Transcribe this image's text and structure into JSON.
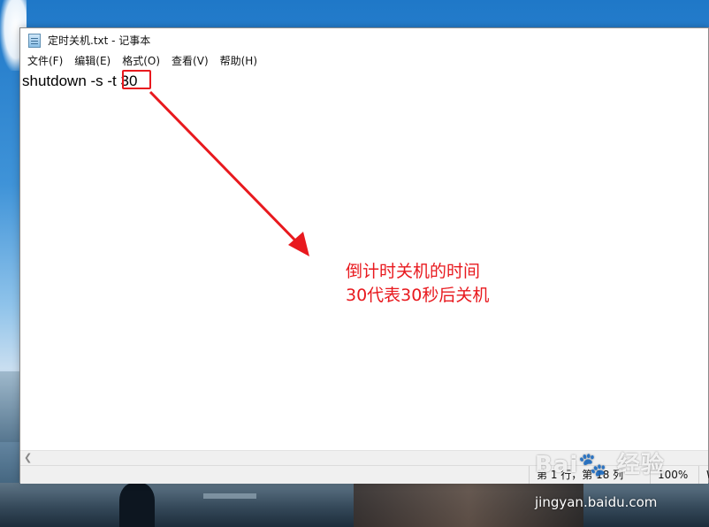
{
  "window": {
    "title": "定时关机.txt - 记事本",
    "icon": "notepad-icon"
  },
  "menu": [
    {
      "label": "文件(F)"
    },
    {
      "label": "编辑(E)"
    },
    {
      "label": "格式(O)"
    },
    {
      "label": "查看(V)"
    },
    {
      "label": "帮助(H)"
    }
  ],
  "editor": {
    "prefix": "shutdown -s -t ",
    "highlighted_value": "30"
  },
  "statusbar": {
    "position": "第 1 行，第 18 列",
    "zoom": "100%",
    "encoding": "W"
  },
  "annotation": {
    "line1": "倒计时关机的时间",
    "line2": "30代表30秒后关机",
    "color": "#e8191e"
  },
  "watermark": {
    "logo": "Bai🐾 经验",
    "url": "jingyan.baidu.com"
  }
}
